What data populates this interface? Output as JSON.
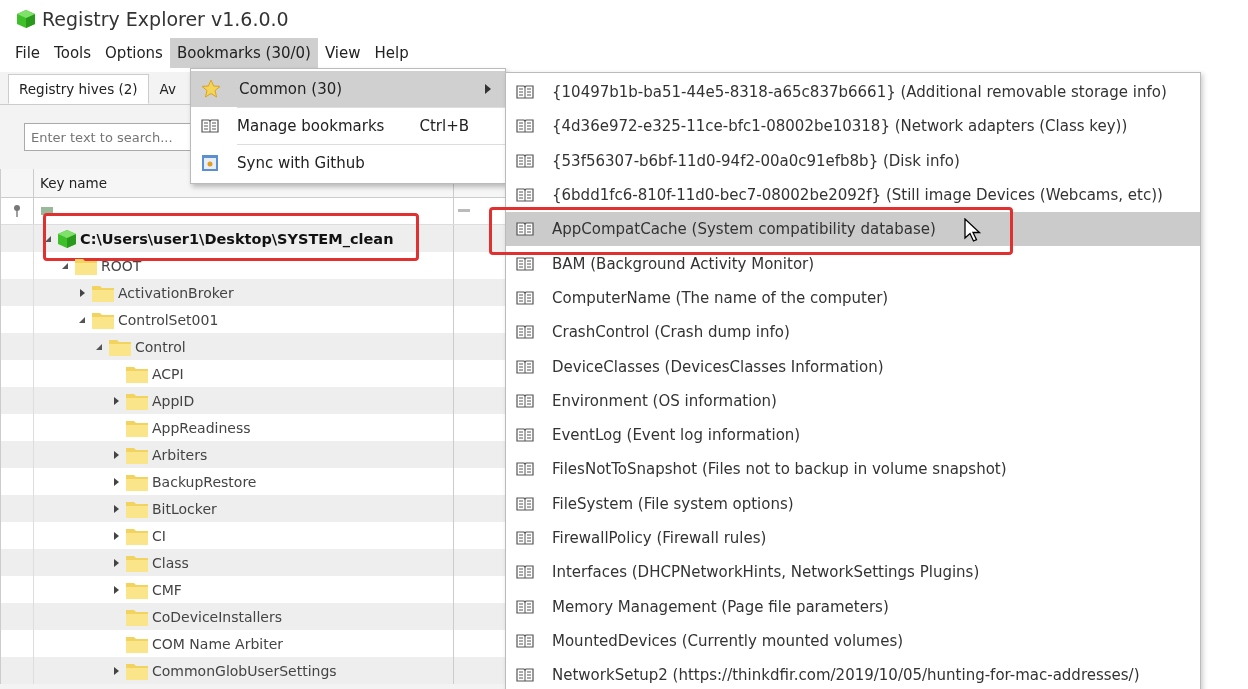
{
  "window": {
    "title": "Registry Explorer v1.6.0.0"
  },
  "menu_bar": [
    {
      "label": "File",
      "selected": false
    },
    {
      "label": "Tools",
      "selected": false
    },
    {
      "label": "Options",
      "selected": false
    },
    {
      "label": "Bookmarks (30/0)",
      "selected": true
    },
    {
      "label": "View",
      "selected": false
    },
    {
      "label": "Help",
      "selected": false
    }
  ],
  "tabs": [
    {
      "label": "Registry hives (2)",
      "selected": true
    },
    {
      "label": "Av",
      "selected": false
    }
  ],
  "search": {
    "placeholder": "Enter text to search..."
  },
  "grid": {
    "columns": [
      "Key name"
    ],
    "tree": [
      {
        "label": "C:\\Users\\user1\\Desktop\\SYSTEM_clean",
        "kind": "hive",
        "has_children": true,
        "expanded": true,
        "annotated": true,
        "children": [
          {
            "label": "ROOT",
            "kind": "folder",
            "has_children": true,
            "expanded": true,
            "children": [
              {
                "label": "ActivationBroker",
                "kind": "folder",
                "has_children": true,
                "expanded": false
              },
              {
                "label": "ControlSet001",
                "kind": "folder",
                "has_children": true,
                "expanded": true,
                "children": [
                  {
                    "label": "Control",
                    "kind": "folder",
                    "has_children": true,
                    "expanded": true,
                    "children": [
                      {
                        "label": "ACPI",
                        "kind": "folder",
                        "has_children": false
                      },
                      {
                        "label": "AppID",
                        "kind": "folder",
                        "has_children": true,
                        "expanded": false
                      },
                      {
                        "label": "AppReadiness",
                        "kind": "folder",
                        "has_children": false
                      },
                      {
                        "label": "Arbiters",
                        "kind": "folder",
                        "has_children": true,
                        "expanded": false
                      },
                      {
                        "label": "BackupRestore",
                        "kind": "folder",
                        "has_children": true,
                        "expanded": false
                      },
                      {
                        "label": "BitLocker",
                        "kind": "folder",
                        "has_children": true,
                        "expanded": false
                      },
                      {
                        "label": "CI",
                        "kind": "folder",
                        "has_children": true,
                        "expanded": false
                      },
                      {
                        "label": "Class",
                        "kind": "folder",
                        "has_children": true,
                        "expanded": false
                      },
                      {
                        "label": "CMF",
                        "kind": "folder",
                        "has_children": true,
                        "expanded": false
                      },
                      {
                        "label": "CoDeviceInstallers",
                        "kind": "folder",
                        "has_children": false
                      },
                      {
                        "label": "COM Name Arbiter",
                        "kind": "folder",
                        "has_children": false
                      },
                      {
                        "label": "CommonGlobUserSettings",
                        "kind": "folder",
                        "has_children": true,
                        "expanded": false
                      }
                    ]
                  }
                ]
              }
            ]
          }
        ]
      }
    ]
  },
  "bookmarks_menu": [
    {
      "label": "Common (30)",
      "kind": "star",
      "selected": true,
      "submenu": true
    },
    {
      "label": "Manage bookmarks",
      "kind": "book",
      "shortcut": "Ctrl+B",
      "selected": false,
      "submenu": false
    },
    {
      "label": "Sync with Github",
      "kind": "sync",
      "selected": false,
      "submenu": false
    }
  ],
  "common_submenu": [
    {
      "label": "{10497b1b-ba51-44e5-8318-a65c837b6661} (Additional removable storage info)",
      "selected": false,
      "annotated": false
    },
    {
      "label": "{4d36e972-e325-11ce-bfc1-08002be10318} (Network adapters (Class key))",
      "selected": false,
      "annotated": false
    },
    {
      "label": "{53f56307-b6bf-11d0-94f2-00a0c91efb8b} (Disk info)",
      "selected": false,
      "annotated": false
    },
    {
      "label": "{6bdd1fc6-810f-11d0-bec7-08002be2092f} (Still image Devices (Webcams, etc))",
      "selected": false,
      "annotated": false
    },
    {
      "label": "AppCompatCache (System compatibility database)",
      "selected": true,
      "annotated": true
    },
    {
      "label": "BAM (Background Activity Monitor)",
      "selected": false,
      "annotated": false
    },
    {
      "label": "ComputerName (The name of the computer)",
      "selected": false,
      "annotated": false
    },
    {
      "label": "CrashControl (Crash dump info)",
      "selected": false,
      "annotated": false
    },
    {
      "label": "DeviceClasses (DevicesClasses Information)",
      "selected": false,
      "annotated": false
    },
    {
      "label": "Environment (OS information)",
      "selected": false,
      "annotated": false
    },
    {
      "label": "EventLog (Event log information)",
      "selected": false,
      "annotated": false
    },
    {
      "label": "FilesNotToSnapshot (Files not to backup in volume snapshot)",
      "selected": false,
      "annotated": false
    },
    {
      "label": "FileSystem (File system options)",
      "selected": false,
      "annotated": false
    },
    {
      "label": "FirewallPolicy (Firewall rules)",
      "selected": false,
      "annotated": false
    },
    {
      "label": "Interfaces (DHCPNetworkHints, NetworkSettings Plugins)",
      "selected": false,
      "annotated": false
    },
    {
      "label": "Memory Management (Page file parameters)",
      "selected": false,
      "annotated": false
    },
    {
      "label": "MountedDevices (Currently mounted volumes)",
      "selected": false,
      "annotated": false
    },
    {
      "label": "NetworkSetup2 (https://thinkdfir.com/2019/10/05/hunting-for-mac-addresses/)",
      "selected": false,
      "annotated": false
    }
  ]
}
